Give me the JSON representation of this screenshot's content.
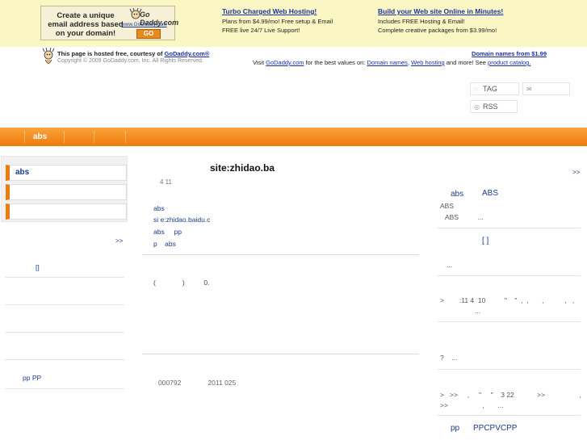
{
  "banner": {
    "ad": {
      "lines": [
        "Create a unique",
        "email address based",
        "on your domain!"
      ],
      "logo": "Go Daddy.com",
      "url": "www.GoDaddy.com",
      "go": "GO"
    },
    "promo1": {
      "title": "Turbo Charged Web Hosting!",
      "line1": "Plans from $4.99/mo! Free setup & Email",
      "line2": "FREE live 24/7 Live Support!"
    },
    "promo2": {
      "title": "Build your Web site Online in Minutes!",
      "line1": "Includes FREE Hosting & Email!",
      "line2": "Complete creative packages from $3.99/mo!"
    }
  },
  "hosted": {
    "text": "This page is hosted free, courtesy of ",
    "link": "GoDaddy.com®",
    "copyright": "Copyright © 2009 GoDaddy.com, Inc. All Rights Reserved.",
    "domain_link": "Domain names from $1.99",
    "visit_prefix": "Visit ",
    "visit_link": "GoDaddy.com",
    "visit_mid": " for the best values on: ",
    "visit_domain": "Domain names",
    "visit_comma": ", ",
    "visit_hosting": "Web hosting",
    "visit_more": " and more! See ",
    "visit_catalog": "product catalog."
  },
  "tools": {
    "tag_label": "TAG",
    "rss_label": "RSS"
  },
  "nav": {
    "items": [
      "abs"
    ]
  },
  "left": {
    "tabs": [
      "abs",
      "",
      ""
    ],
    "more": ">>",
    "rows": [
      "[]",
      "",
      "",
      "",
      "pp    PP"
    ]
  },
  "main": {
    "title": "site:zhidao.ba",
    "meta": "4 11",
    "links": [
      "abs",
      "si e:zhidao.baidu.c",
      "abs     pp",
      "p    abs"
    ],
    "quote": "(              )          0.",
    "footer": "000792              2011 025"
  },
  "right": {
    "more": ">>",
    "head1_a": "abs",
    "head1_b": "ABS",
    "sub1": "ABS",
    "sub2": "ABS          ...",
    "link2": "[ ]",
    "t1": "...",
    "t2": ">        :11 4  10          \"    \"  ,  ,       ,           ,   ,",
    "t2b": "...",
    "t3": "?    ...",
    "t4": ">   >>     ,     \"     \"    3 22            >>                  ,",
    "t4b": ">>                  ,       ...",
    "foot_a": "pp",
    "foot_b": "PPCPVCPP"
  },
  "colors": {
    "nav_orange": "#ee7b0c",
    "banner_bg": "#fbf7c5",
    "link_blue": "#1a3b8f"
  }
}
